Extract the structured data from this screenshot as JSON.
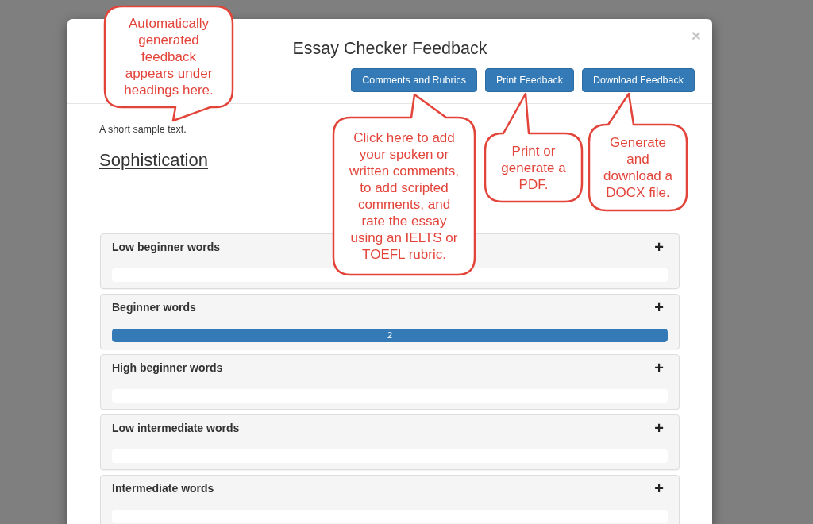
{
  "modal": {
    "title": "Essay Checker Feedback",
    "close": "×",
    "buttons": [
      {
        "label": "Comments and Rubrics"
      },
      {
        "label": "Print Feedback"
      },
      {
        "label": "Download Feedback"
      }
    ]
  },
  "body": {
    "sample_text": "A short sample text.",
    "section_heading": "Sophistication"
  },
  "panels": [
    {
      "title": "Low beginner words",
      "toggle": "+"
    },
    {
      "title": "Beginner words",
      "toggle": "+",
      "level": 1,
      "reading": "2"
    },
    {
      "title": "High beginner words",
      "toggle": "+"
    },
    {
      "title": "Low intermediate words",
      "toggle": "+"
    },
    {
      "title": "Intermediate words",
      "toggle": "+"
    }
  ],
  "callouts": [
    {
      "text": "Automatically generated feedback appears under headings here."
    },
    {
      "text": "Click here to add your spoken or written comments, to add scripted comments, and rate the essay using an IELTS or TOEFL rubric."
    },
    {
      "text": "Print or generate a PDF."
    },
    {
      "text": "Generate and download a DOCX file."
    }
  ]
}
